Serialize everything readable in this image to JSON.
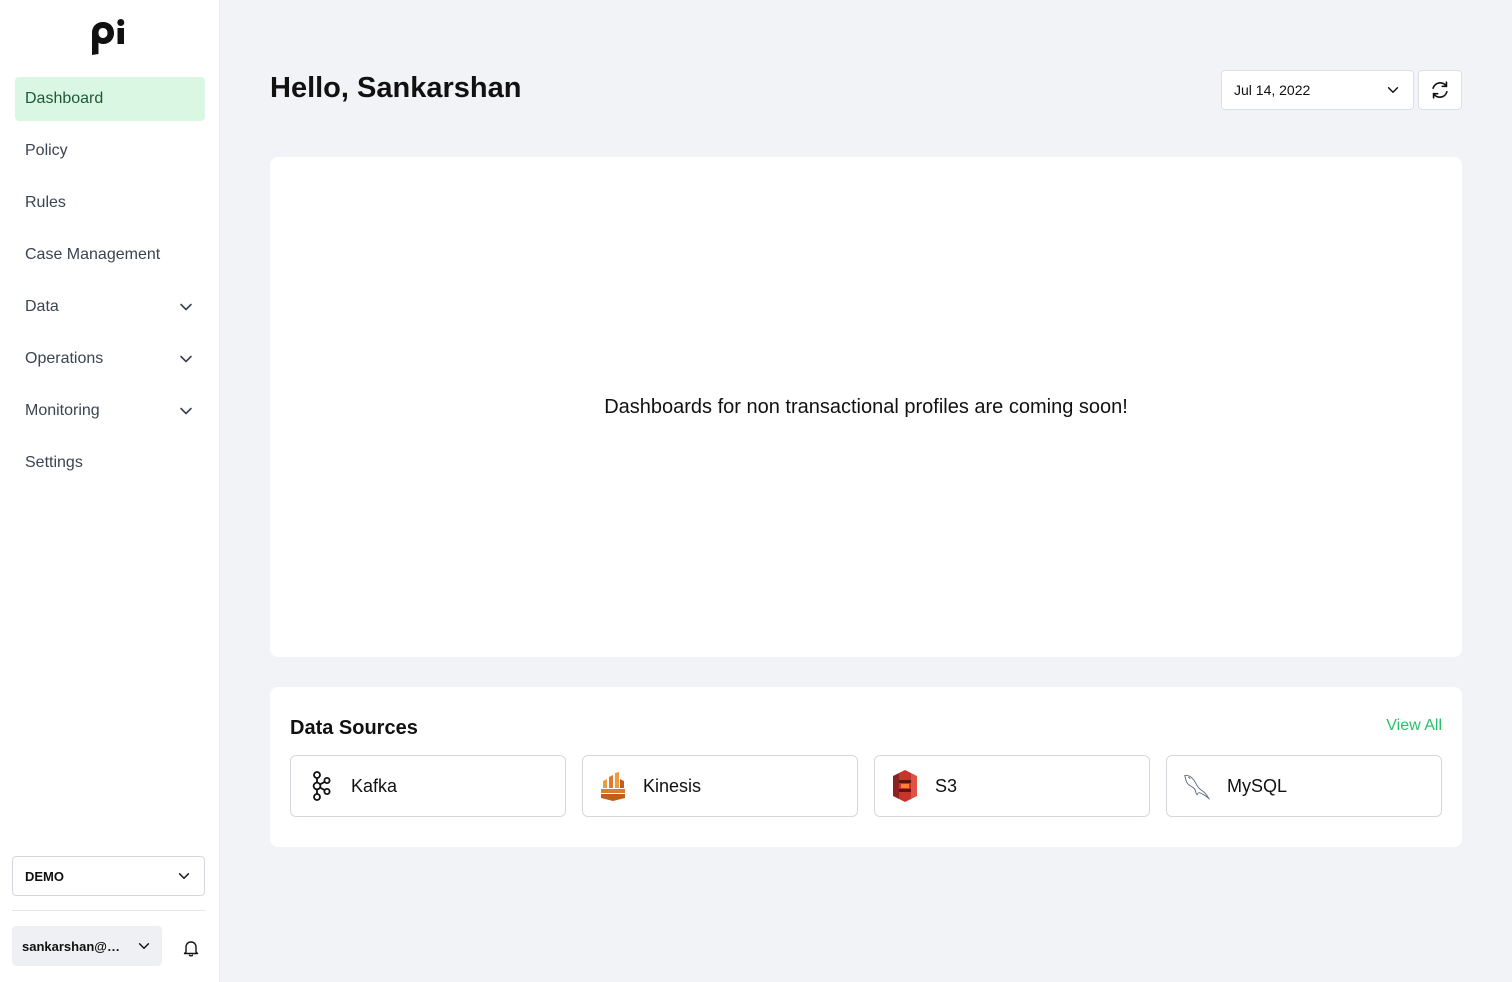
{
  "sidebar": {
    "nav": [
      {
        "label": "Dashboard"
      },
      {
        "label": "Policy"
      },
      {
        "label": "Rules"
      },
      {
        "label": "Case Management"
      },
      {
        "label": "Data"
      },
      {
        "label": "Operations"
      },
      {
        "label": "Monitoring"
      },
      {
        "label": "Settings"
      }
    ],
    "org": "DEMO",
    "user": "sankarshan@p..."
  },
  "header": {
    "title": "Hello, Sankarshan",
    "date": "Jul 14, 2022"
  },
  "main": {
    "message": "Dashboards for non transactional profiles are coming soon!"
  },
  "data_sources": {
    "title": "Data Sources",
    "view_all": "View All",
    "items": [
      {
        "label": "Kafka"
      },
      {
        "label": "Kinesis"
      },
      {
        "label": "S3"
      },
      {
        "label": "MySQL"
      }
    ]
  },
  "colors": {
    "accent": "#27c267",
    "active_nav_bg": "#d9f7e3"
  }
}
